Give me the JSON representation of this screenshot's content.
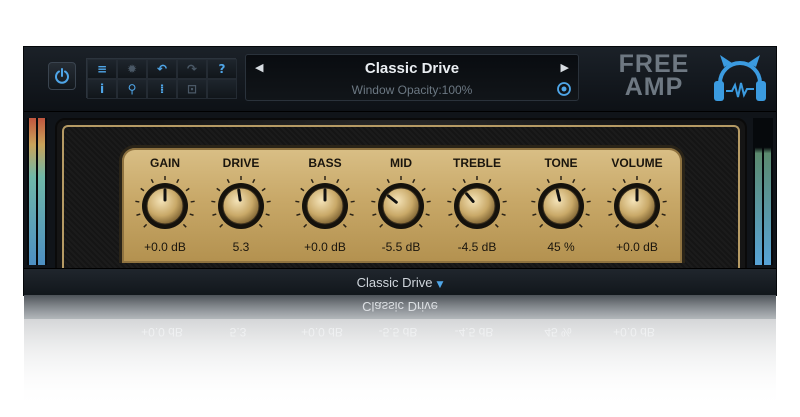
{
  "header": {
    "preset_name": "Classic Drive",
    "status_text": "Window Opacity:100%",
    "brand_line1": "FREE",
    "brand_line2": "AMP",
    "toolbar_icons": [
      "menu-icon",
      "gear-icon",
      "undo-icon",
      "redo-icon",
      "help-icon",
      "info-icon",
      "search-icon",
      "bars-icon",
      "lock-icon"
    ],
    "toolbar_glyphs": {
      "menu": "≡",
      "settings": "✹",
      "undo": "↶",
      "redo": "↷",
      "help": "?",
      "info": "i",
      "search": "⚲",
      "levels": "⁞",
      "lock": "⊡"
    }
  },
  "knobs": [
    {
      "label": "GAIN",
      "value": "+0.0 dB",
      "position": 0.5
    },
    {
      "label": "DRIVE",
      "value": "5.3",
      "position": 0.47
    },
    {
      "label": "BASS",
      "value": "+0.0 dB",
      "position": 0.5
    },
    {
      "label": "MID",
      "value": "-5.5 dB",
      "position": 0.31
    },
    {
      "label": "TREBLE",
      "value": "-4.5 dB",
      "position": 0.35
    },
    {
      "label": "TONE",
      "value": "45 %",
      "position": 0.45
    },
    {
      "label": "VOLUME",
      "value": "+0.0 dB",
      "position": 0.5
    }
  ],
  "footer": {
    "preset_label": "Classic Drive"
  },
  "colors": {
    "accent": "#4fa6e8",
    "panel_gold": "#c8a868",
    "frame_dark": "#101419"
  }
}
